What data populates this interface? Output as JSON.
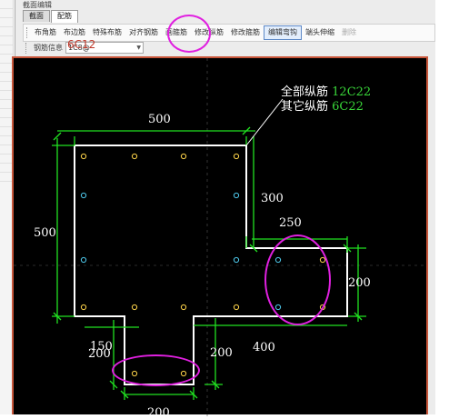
{
  "window": {
    "title": "截面编辑"
  },
  "tabs": [
    {
      "label": "截面"
    },
    {
      "label": "配筋"
    }
  ],
  "toolbar": [
    {
      "label": "布角筋"
    },
    {
      "label": "布边筋"
    },
    {
      "label": "特殊布筋"
    },
    {
      "label": "对齐钢筋"
    },
    {
      "label": "画箍筋"
    },
    {
      "label": "修改纵筋"
    },
    {
      "label": "修改箍筋"
    },
    {
      "label": "编辑弯钩"
    },
    {
      "label": "端头伸缩"
    },
    {
      "label": "删除"
    }
  ],
  "rebar_row": {
    "label": "钢筋信息",
    "select_value": "1C8@",
    "overlay_value": "6C12"
  },
  "callout": {
    "line1_label": "全部纵筋",
    "line1_value": "12C22",
    "line2_label": "其它纵筋",
    "line2_value": "6C22"
  },
  "dims": {
    "top": "500",
    "left": "500",
    "right_notch_v": "300",
    "right_notch_h": "250",
    "right_end": "200",
    "bottom_right": "400",
    "stem_right": "200",
    "stem_left_150": "150",
    "stem_left_200": "200",
    "stem_bottom": "200"
  },
  "colors": {
    "shape": "#ffffff",
    "dim": "#21e121",
    "rebar": "#ffd54a",
    "rebar_alt": "#4ec9ec",
    "annotation": "#e020e0"
  }
}
